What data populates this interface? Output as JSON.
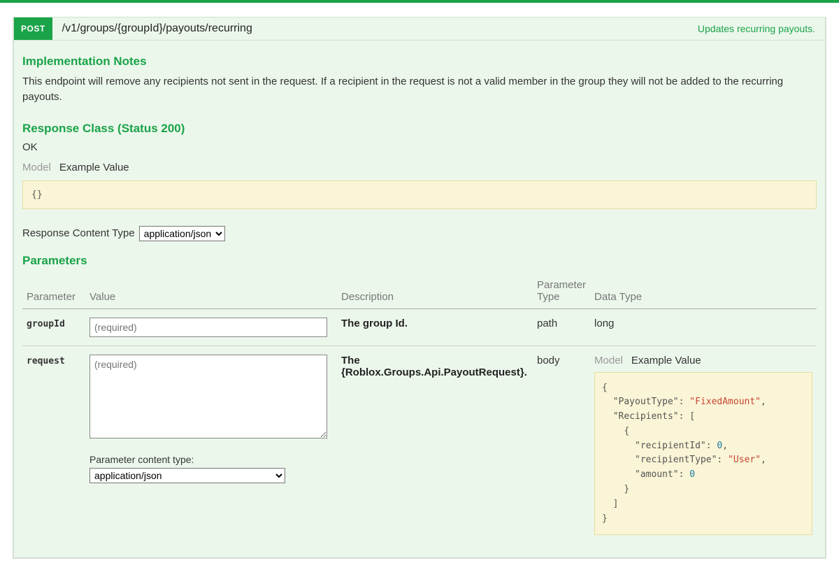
{
  "method": "POST",
  "path": "/v1/groups/{groupId}/payouts/recurring",
  "summary": "Updates recurring payouts.",
  "implNotes": {
    "heading": "Implementation Notes",
    "body": "This endpoint will remove any recipients not sent in the request. If a recipient in the request is not a valid member in the group they will not be added to the recurring payouts."
  },
  "responseClass": {
    "heading": "Response Class (Status 200)",
    "status": "OK",
    "tabs": {
      "model": "Model",
      "example": "Example Value"
    },
    "exampleBody": "{}"
  },
  "responseContentType": {
    "label": "Response Content Type",
    "value": "application/json"
  },
  "parametersHeading": "Parameters",
  "columns": {
    "param": "Parameter",
    "value": "Value",
    "desc": "Description",
    "ptype": "Parameter Type",
    "dtype": "Data Type"
  },
  "rows": [
    {
      "name": "groupId",
      "placeholder": "(required)",
      "desc": "The group Id.",
      "ptype": "path",
      "dtype": "long",
      "kind": "text"
    },
    {
      "name": "request",
      "placeholder": "(required)",
      "desc": "The {Roblox.Groups.Api.PayoutRequest}.",
      "ptype": "body",
      "kind": "textarea",
      "contentTypeLabel": "Parameter content type:",
      "contentTypeValue": "application/json",
      "modelTabs": {
        "model": "Model",
        "example": "Example Value"
      }
    }
  ],
  "datatypeExample": {
    "lines": [
      "{",
      "  \"PayoutType\": \"FixedAmount\",",
      "  \"Recipients\": [",
      "    {",
      "      \"recipientId\": 0,",
      "      \"recipientType\": \"User\",",
      "      \"amount\": 0",
      "    }",
      "  ]",
      "}"
    ]
  }
}
